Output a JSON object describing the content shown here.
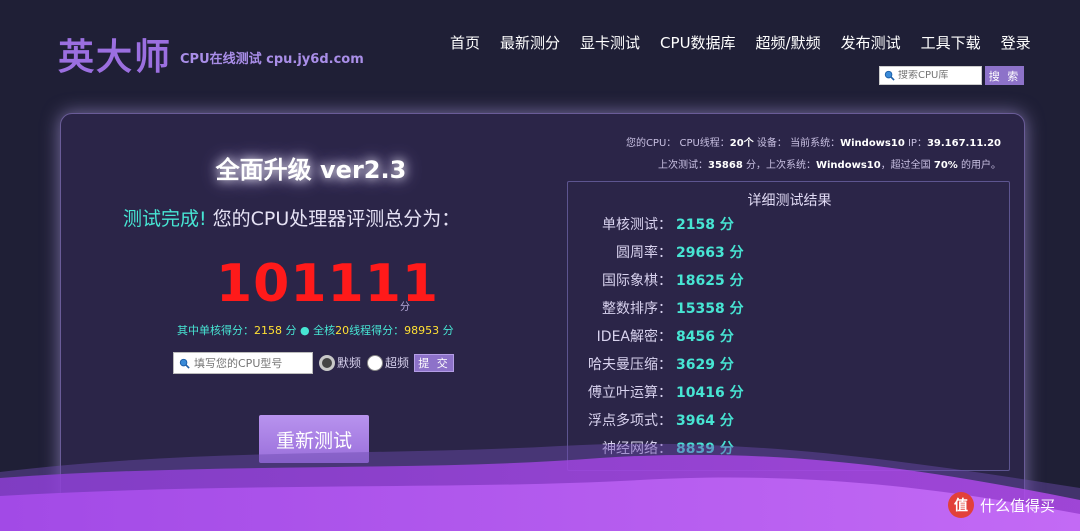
{
  "header": {
    "logo": "英大师",
    "tagline": "CPU在线测试 cpu.jy6d.com",
    "nav": [
      "首页",
      "最新测分",
      "显卡测试",
      "CPU数据库",
      "超频/默频",
      "发布测试",
      "工具下载",
      "登录"
    ],
    "search_placeholder": "搜索CPU库",
    "search_button": "搜 索"
  },
  "main": {
    "upgrade_title": "全面升级 ver2.3",
    "complete_highlight": "测试完成!",
    "complete_rest": " 您的CPU处理器评测总分为：",
    "total_score": "101111",
    "score_unit": "分",
    "single_prefix": "其中单核得分：",
    "single_score": "2158",
    "single_suffix": " 分 ● 全核",
    "threads": "20",
    "multi_prefix": "线程得分：",
    "multi_score": "98953",
    "multi_suffix": " 分",
    "cpu_input_placeholder": "填写您的CPU型号",
    "radio_default": "默频",
    "radio_oc": "超频",
    "submit_button": "提 交",
    "retest_button": "重新测试"
  },
  "info": {
    "line1_a": "您的CPU：  CPU线程：",
    "line1_threads": "20个",
    "line1_b": " 设备：  当前系统：",
    "line1_os": "Windows10",
    "line1_c": " IP：",
    "line1_ip": "39.167.11.20",
    "line2_a": "上次测试：",
    "line2_score": "35868",
    "line2_b": " 分，上次系统：",
    "line2_os": "Windows10",
    "line2_c": "，超过全国 ",
    "line2_pct": "70%",
    "line2_d": " 的用户。"
  },
  "detail": {
    "title": "详细测试结果",
    "rows": [
      {
        "label": "单核测试：",
        "value": "2158 分"
      },
      {
        "label": "圆周率：",
        "value": "29663 分"
      },
      {
        "label": "国际象棋：",
        "value": "18625 分"
      },
      {
        "label": "整数排序：",
        "value": "15358 分"
      },
      {
        "label": "IDEA解密：",
        "value": "8456 分"
      },
      {
        "label": "哈夫曼压缩：",
        "value": "3629 分"
      },
      {
        "label": "傅立叶运算：",
        "value": "10416 分"
      },
      {
        "label": "浮点多项式：",
        "value": "3964 分"
      },
      {
        "label": "神经网络：",
        "value": "8839 分"
      }
    ]
  },
  "watermark": {
    "badge": "值",
    "text": "什么值得买"
  },
  "colors": {
    "accent": "#8d72c9",
    "score_red": "#ff1a1a",
    "cyan": "#47e5d3",
    "yellow": "#ffe033",
    "background": "#1f1f36"
  }
}
